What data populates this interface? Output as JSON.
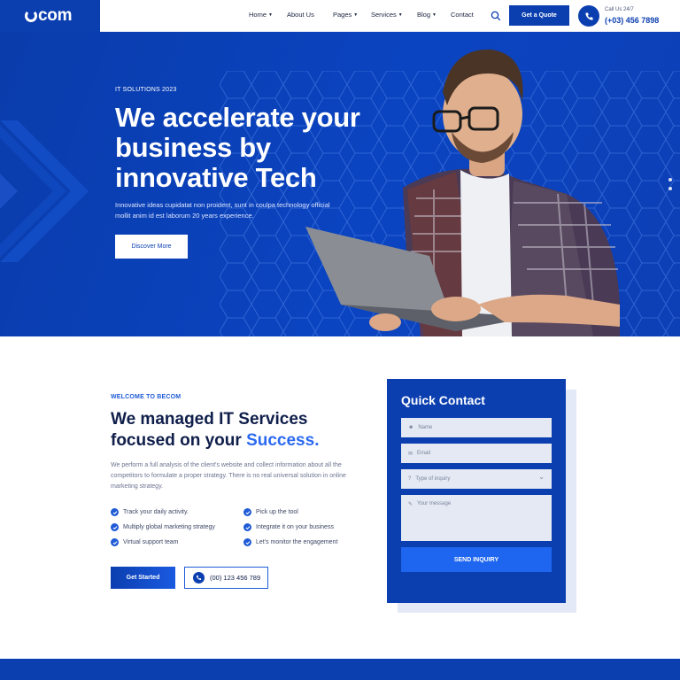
{
  "brand": {
    "name": "com"
  },
  "nav": {
    "items": [
      {
        "label": "Home",
        "dropdown": true
      },
      {
        "label": "About Us",
        "dropdown": false
      },
      {
        "label": "Pages",
        "dropdown": true
      },
      {
        "label": "Services",
        "dropdown": true
      },
      {
        "label": "Blog",
        "dropdown": true
      },
      {
        "label": "Contact",
        "dropdown": false
      }
    ],
    "quote_label": "Get a Quote",
    "call_label": "Call Us 24/7",
    "call_number": "(+03) 456 7898"
  },
  "hero": {
    "eyebrow": "IT SOLUTIONS 2023",
    "headline": "We accelerate your business by innovative Tech",
    "description": "Innovative ideas cupidatat non proident, sunt in coulpa technology official mollit anim id est laborum 20 years experience.",
    "cta": "Discover More"
  },
  "services": {
    "eyebrow": "WELCOME TO BECOM",
    "title_main": "We managed IT Services focused on your",
    "title_highlight": "Success.",
    "description": "We perform a full analysis of the client's website and collect information about all the competitors to formulate a proper strategy. There is no real universal solution in online marketing strategy.",
    "checklist": [
      "Track your daily activity.",
      "Pick up the tool",
      "Multiply global marketing strategy",
      "Integrate it on your business",
      "Virtual support team",
      "Let's monitor the engagement"
    ],
    "cta": "Get Started",
    "phone": "(00) 123 456 789"
  },
  "contact": {
    "title": "Quick Contact",
    "name_placeholder": "Name",
    "email_placeholder": "Email",
    "inquiry_placeholder": "Type of inquiry",
    "message_placeholder": "Your message",
    "submit": "SEND INQUIRY"
  },
  "colors": {
    "primary": "#0b3fb0",
    "accent": "#2b6af0"
  }
}
